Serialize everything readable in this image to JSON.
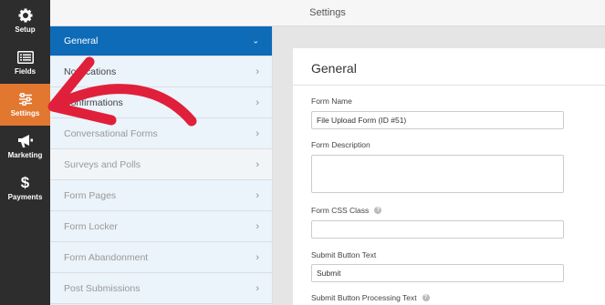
{
  "sidebar": {
    "items": [
      {
        "label": "Setup",
        "icon": "gear-icon",
        "active": false
      },
      {
        "label": "Fields",
        "icon": "fields-list-icon",
        "active": false
      },
      {
        "label": "Settings",
        "icon": "sliders-icon",
        "active": true
      },
      {
        "label": "Marketing",
        "icon": "megaphone-icon",
        "active": false
      },
      {
        "label": "Payments",
        "icon": "dollar-icon",
        "active": false
      }
    ],
    "background": "#2d2d2d",
    "active_color": "#e27730"
  },
  "header": {
    "title": "Settings"
  },
  "settings_nav": {
    "items": [
      {
        "label": "General",
        "state": "active"
      },
      {
        "label": "Notifications",
        "state": "enabled"
      },
      {
        "label": "Confirmations",
        "state": "enabled"
      },
      {
        "label": "Conversational Forms",
        "state": "disabled"
      },
      {
        "label": "Surveys and Polls",
        "state": "disabled"
      },
      {
        "label": "Form Pages",
        "state": "disabled"
      },
      {
        "label": "Form Locker",
        "state": "disabled"
      },
      {
        "label": "Form Abandonment",
        "state": "disabled"
      },
      {
        "label": "Post Submissions",
        "state": "disabled"
      }
    ],
    "active_color": "#0e6bb8"
  },
  "panel": {
    "title": "General",
    "form_name_label": "Form Name",
    "form_name_value": "File Upload Form (ID #51)",
    "form_description_label": "Form Description",
    "form_description_value": "",
    "form_css_class_label": "Form CSS Class",
    "form_css_class_value": "",
    "submit_text_label": "Submit Button Text",
    "submit_text_value": "Submit",
    "submit_processing_label": "Submit Button Processing Text"
  },
  "annotation": {
    "color": "#e0203a",
    "shape": "curved-arrow"
  }
}
